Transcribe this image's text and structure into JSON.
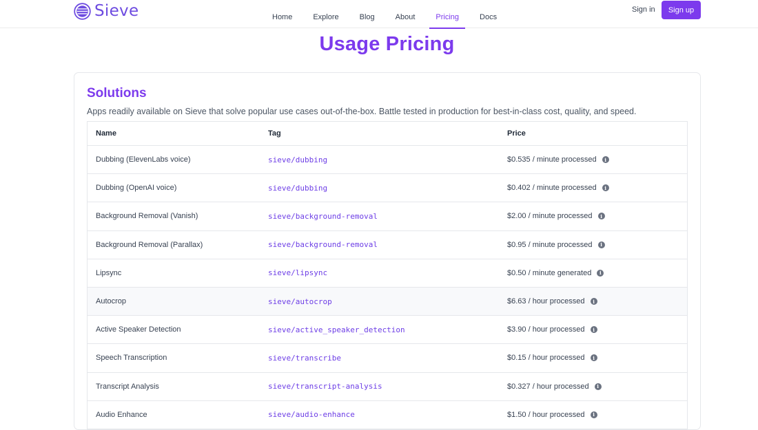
{
  "brand": {
    "name": "Sieve",
    "color": "#7c3aed"
  },
  "nav": {
    "links": [
      "Home",
      "Explore",
      "Blog",
      "About",
      "Pricing",
      "Docs"
    ],
    "active": "Pricing",
    "signin": "Sign in",
    "signup": "Sign up"
  },
  "page": {
    "title": "Usage Pricing"
  },
  "solutions": {
    "title": "Solutions",
    "description": "Apps readily available on Sieve that solve popular use cases out-of-the-box. Battle tested in production for best-in-class cost, quality, and speed.",
    "columns": [
      "Name",
      "Tag",
      "Price"
    ],
    "rows": [
      {
        "name": "Dubbing (ElevenLabs voice)",
        "tag": "sieve/dubbing",
        "price": "$0.535 / minute processed"
      },
      {
        "name": "Dubbing (OpenAI voice)",
        "tag": "sieve/dubbing",
        "price": "$0.402 / minute processed"
      },
      {
        "name": "Background Removal (Vanish)",
        "tag": "sieve/background-removal",
        "price": "$2.00 / minute processed"
      },
      {
        "name": "Background Removal (Parallax)",
        "tag": "sieve/background-removal",
        "price": "$0.95 / minute processed"
      },
      {
        "name": "Lipsync",
        "tag": "sieve/lipsync",
        "price": "$0.50 / minute generated"
      },
      {
        "name": "Autocrop",
        "tag": "sieve/autocrop",
        "price": "$6.63 / hour processed"
      },
      {
        "name": "Active Speaker Detection",
        "tag": "sieve/active_speaker_detection",
        "price": "$3.90 / hour processed"
      },
      {
        "name": "Speech Transcription",
        "tag": "sieve/transcribe",
        "price": "$0.15 / hour processed"
      },
      {
        "name": "Transcript Analysis",
        "tag": "sieve/transcript-analysis",
        "price": "$0.327 / hour processed"
      },
      {
        "name": "Audio Enhance",
        "tag": "sieve/audio-enhance",
        "price": "$1.50 / hour processed"
      }
    ]
  }
}
